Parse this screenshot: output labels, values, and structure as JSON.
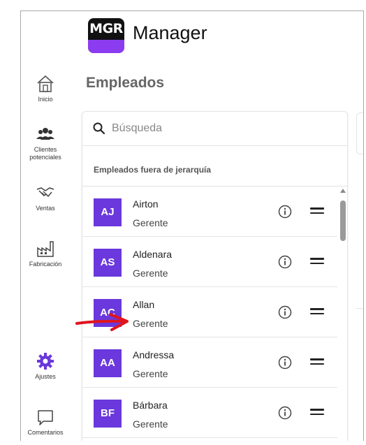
{
  "app": {
    "logo_text": "MGR",
    "title": "Manager"
  },
  "page": {
    "title": "Empleados"
  },
  "sidebar": {
    "items": [
      {
        "label": "Inicio",
        "icon": "home-icon"
      },
      {
        "label": "Clientes potenciales",
        "icon": "people-icon"
      },
      {
        "label": "Ventas",
        "icon": "handshake-icon"
      },
      {
        "label": "Fabricación",
        "icon": "factory-icon"
      },
      {
        "label": "Ajustes",
        "icon": "gear-icon"
      },
      {
        "label": "Comentarios",
        "icon": "chat-icon"
      }
    ]
  },
  "search": {
    "placeholder": "Búsqueda",
    "value": ""
  },
  "section": {
    "header": "Empleados fuera de jerarquía"
  },
  "employees": [
    {
      "initials": "AJ",
      "name": "Airton",
      "role": "Gerente"
    },
    {
      "initials": "AS",
      "name": "Aldenara",
      "role": "Gerente"
    },
    {
      "initials": "AC",
      "name": "Allan",
      "role": "Gerente"
    },
    {
      "initials": "AA",
      "name": "Andressa",
      "role": "Gerente"
    },
    {
      "initials": "BF",
      "name": "Bárbara",
      "role": "Gerente"
    }
  ],
  "colors": {
    "avatar": "#6a38dc",
    "accent": "#8c3cf0",
    "annotation_arrow": "#e0141e"
  }
}
